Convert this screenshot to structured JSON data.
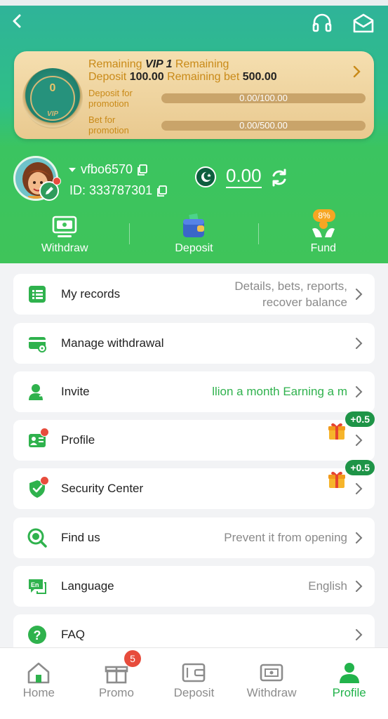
{
  "colors": {
    "primary_green": "#3fc45a",
    "teal": "#2fb39a",
    "gold": "#c98a18",
    "accent_text_green": "#2fb24d",
    "badge_red": "#e74c3c"
  },
  "header": {
    "back_icon": "chevron-left-icon",
    "support_icon": "headset-icon",
    "mail_icon": "mail-icon"
  },
  "vip": {
    "medal_level": "0",
    "medal_tag": "VIP",
    "line1_prefix": "Remaining ",
    "line1_level": "VIP 1",
    "line1_suffix": " Remaining",
    "line2_deposit_label": "Deposit ",
    "line2_deposit_value": "100.00",
    "line2_bet_label": " Remaining bet ",
    "line2_bet_value": "500.00",
    "deposit_label": "Deposit for promotion",
    "deposit_progress_text": "0.00/100.00",
    "deposit_progress_fraction": 0,
    "bet_label": "Bet for promotion",
    "bet_progress_text": "0.00/500.00",
    "bet_progress_fraction": 0
  },
  "user": {
    "username": "vfbo6570",
    "id_text": "ID: 333787301",
    "balance": "0.00"
  },
  "quick_actions": [
    {
      "label": "Withdraw",
      "icon": "withdraw-monitor-icon"
    },
    {
      "label": "Deposit",
      "icon": "wallet-icon"
    },
    {
      "label": "Fund",
      "icon": "fund-hands-icon",
      "badge": "8%"
    }
  ],
  "menu": {
    "records": {
      "label": "My records",
      "value_line1": "Details, bets, reports,",
      "value_line2": "recover balance"
    },
    "manage_withdrawal": {
      "label": "Manage withdrawal"
    },
    "invite": {
      "label": "Invite",
      "value": "llion a month  Earning a m"
    },
    "profile": {
      "label": "Profile",
      "bonus": "+0.5"
    },
    "security": {
      "label": "Security Center",
      "bonus": "+0.5"
    },
    "find_us": {
      "label": "Find us",
      "value": "Prevent it from opening"
    },
    "language": {
      "label": "Language",
      "value": "English"
    },
    "faq": {
      "label": "FAQ"
    }
  },
  "bottom_nav": {
    "items": [
      {
        "label": "Home",
        "icon": "home-icon"
      },
      {
        "label": "Promo",
        "icon": "gift-icon",
        "badge": "5"
      },
      {
        "label": "Deposit",
        "icon": "deposit-card-icon"
      },
      {
        "label": "Withdraw",
        "icon": "withdraw-ticket-icon"
      },
      {
        "label": "Profile",
        "icon": "profile-icon"
      }
    ],
    "active": "Profile"
  }
}
